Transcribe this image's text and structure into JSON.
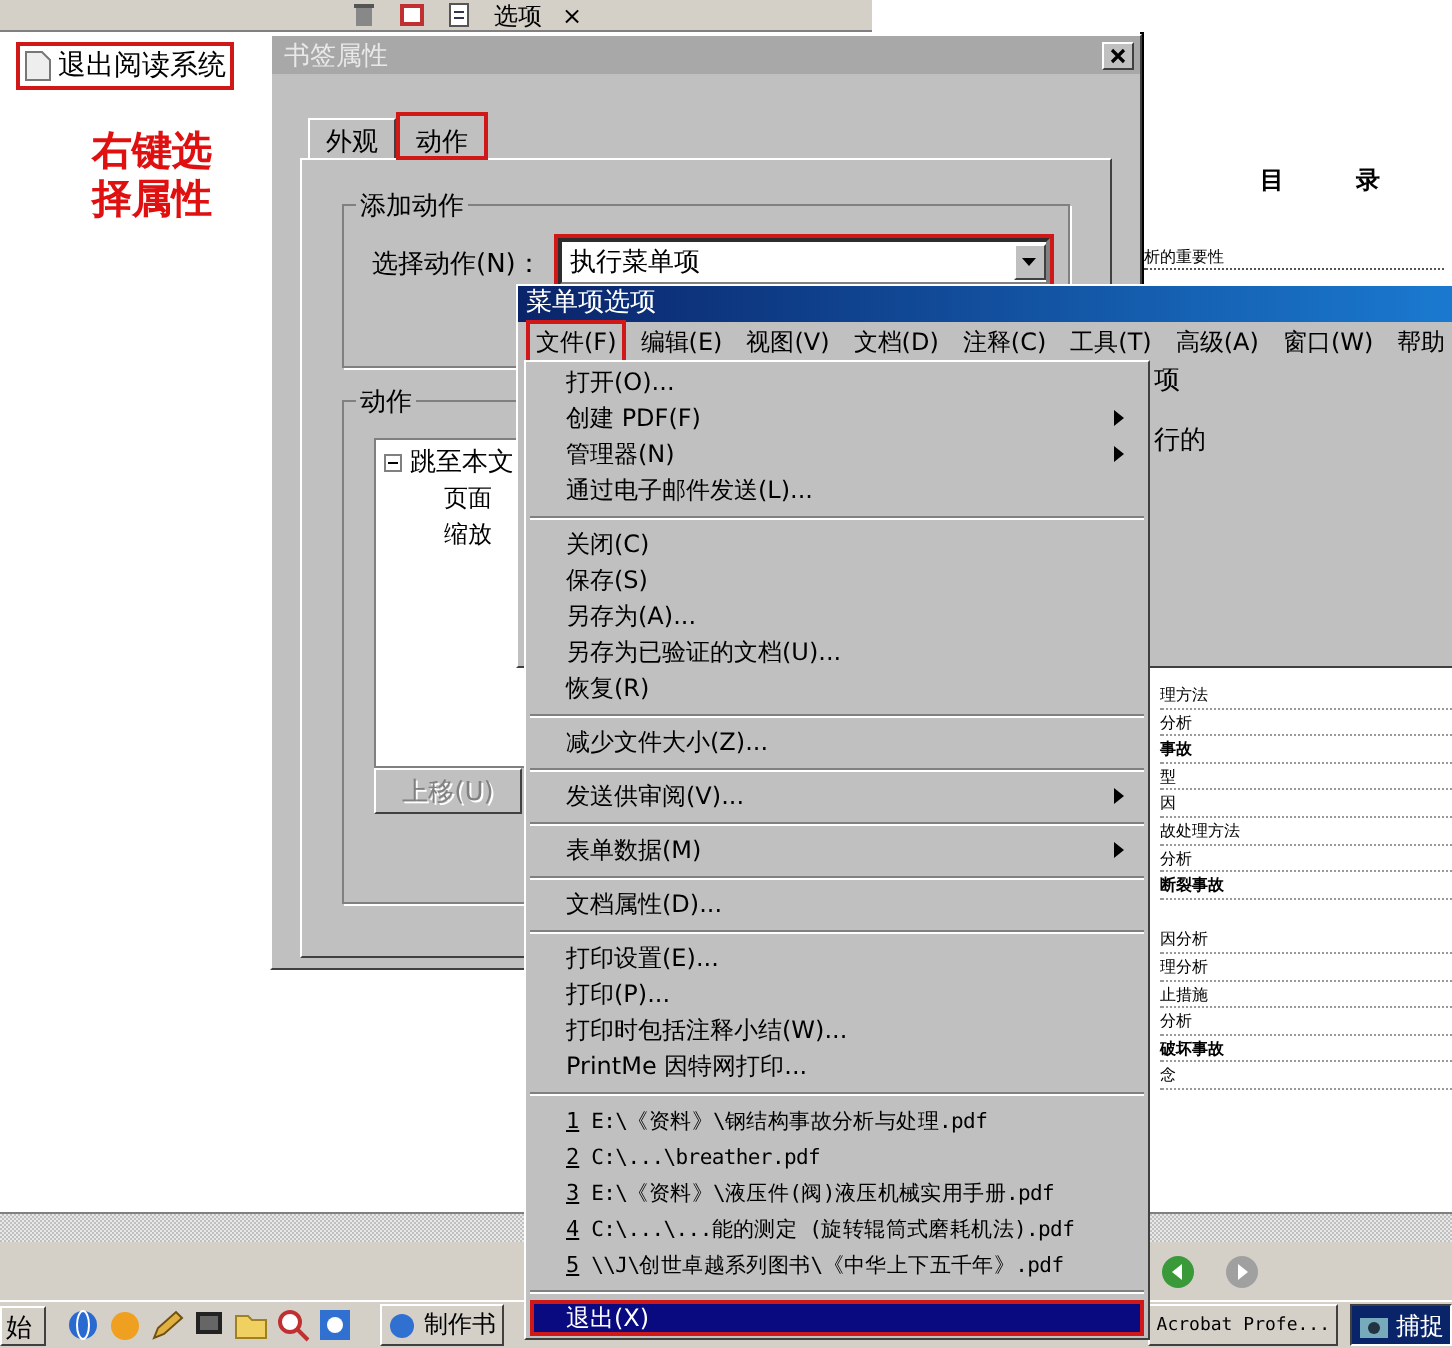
{
  "toolbar": {
    "options_label": "选项",
    "close_label": "×"
  },
  "bookmarks": [
    {
      "label": "退出阅读系统",
      "highlighted": true
    }
  ],
  "annotation": "右键选择属性",
  "document": {
    "heading": [
      "目",
      "录"
    ],
    "first_line": "析的重要性",
    "toc_rows": [
      {
        "text": "理方法",
        "bold": false
      },
      {
        "text": "分析",
        "bold": false
      },
      {
        "text": "事故",
        "bold": true
      },
      {
        "text": "型",
        "bold": false
      },
      {
        "text": "因",
        "bold": false
      },
      {
        "text": "故处理方法",
        "bold": false
      },
      {
        "text": "分析",
        "bold": false
      },
      {
        "text": "断裂事故",
        "bold": true
      },
      {
        "text": "因分析",
        "bold": false
      },
      {
        "text": "理分析",
        "bold": false
      },
      {
        "text": "止措施",
        "bold": false
      },
      {
        "text": "分析",
        "bold": false
      },
      {
        "text": "破坏事故",
        "bold": true
      },
      {
        "text": "念",
        "bold": false
      }
    ]
  },
  "bookmark_dialog": {
    "title": "书签属性",
    "tabs": [
      {
        "label": "外观",
        "selected": false,
        "highlighted": false
      },
      {
        "label": "动作",
        "selected": true,
        "highlighted": true
      }
    ],
    "add_action_group": "添加动作",
    "select_action_label": "选择动作(N)：",
    "select_action_value": "执行菜单项",
    "select_highlighted": true,
    "actions_group": "动作",
    "action_tree": [
      {
        "label": "跳至本文",
        "expanded": true,
        "children": [
          {
            "label": "页面"
          },
          {
            "label": "缩放"
          }
        ]
      }
    ],
    "move_up_button": {
      "label": "上移(U)",
      "disabled": true
    }
  },
  "menu_dialog": {
    "title": "菜单项选项",
    "menubar": [
      {
        "label": "文件(F)",
        "selected": true
      },
      {
        "label": "编辑(E)",
        "selected": false
      },
      {
        "label": "视图(V)",
        "selected": false
      },
      {
        "label": "文档(D)",
        "selected": false
      },
      {
        "label": "注释(C)",
        "selected": false
      },
      {
        "label": "工具(T)",
        "selected": false
      },
      {
        "label": "高级(A)",
        "selected": false
      },
      {
        "label": "窗口(W)",
        "selected": false
      },
      {
        "label": "帮助",
        "selected": false
      }
    ],
    "body_texts": [
      "项",
      "行的"
    ]
  },
  "file_menu": [
    {
      "kind": "item",
      "label": "打开(O)...",
      "submenu": false,
      "selected": false
    },
    {
      "kind": "item",
      "label": "创建 PDF(F)",
      "submenu": true,
      "selected": false
    },
    {
      "kind": "item",
      "label": "管理器(N)",
      "submenu": true,
      "selected": false
    },
    {
      "kind": "item",
      "label": "通过电子邮件发送(L)...",
      "submenu": false,
      "selected": false
    },
    {
      "kind": "separator"
    },
    {
      "kind": "item",
      "label": "关闭(C)",
      "submenu": false,
      "selected": false
    },
    {
      "kind": "item",
      "label": "保存(S)",
      "submenu": false,
      "selected": false
    },
    {
      "kind": "item",
      "label": "另存为(A)...",
      "submenu": false,
      "selected": false
    },
    {
      "kind": "item",
      "label": "另存为已验证的文档(U)...",
      "submenu": false,
      "selected": false
    },
    {
      "kind": "item",
      "label": "恢复(R)",
      "submenu": false,
      "selected": false
    },
    {
      "kind": "separator"
    },
    {
      "kind": "item",
      "label": "减少文件大小(Z)...",
      "submenu": false,
      "selected": false
    },
    {
      "kind": "separator"
    },
    {
      "kind": "item",
      "label": "发送供审阅(V)...",
      "submenu": true,
      "selected": false
    },
    {
      "kind": "separator"
    },
    {
      "kind": "item",
      "label": "表单数据(M)",
      "submenu": true,
      "selected": false
    },
    {
      "kind": "separator"
    },
    {
      "kind": "item",
      "label": "文档属性(D)...",
      "submenu": false,
      "selected": false
    },
    {
      "kind": "separator"
    },
    {
      "kind": "item",
      "label": "打印设置(E)...",
      "submenu": false,
      "selected": false
    },
    {
      "kind": "item",
      "label": "打印(P)...",
      "submenu": false,
      "selected": false
    },
    {
      "kind": "item",
      "label": "打印时包括注释小结(W)...",
      "submenu": false,
      "selected": false
    },
    {
      "kind": "item",
      "label": "PrintMe 因特网打印...",
      "submenu": false,
      "selected": false
    },
    {
      "kind": "separator"
    },
    {
      "kind": "recent",
      "number": "1",
      "label": "E:\\《资料》\\钢结构事故分析与处理.pdf",
      "selected": false
    },
    {
      "kind": "recent",
      "number": "2",
      "label": "C:\\...\\breather.pdf",
      "selected": false
    },
    {
      "kind": "recent",
      "number": "3",
      "label": "E:\\《资料》\\液压件(阀)液压机械实用手册.pdf",
      "selected": false
    },
    {
      "kind": "recent",
      "number": "4",
      "label": "C:\\...\\...能的测定 (旋转辊筒式磨耗机法).pdf",
      "selected": false
    },
    {
      "kind": "recent",
      "number": "5",
      "label": "\\\\J\\创世卓越系列图书\\《中华上下五千年》.pdf",
      "selected": false
    },
    {
      "kind": "separator"
    },
    {
      "kind": "item",
      "label": "退出(X)",
      "submenu": false,
      "selected": true,
      "highlighted": true
    }
  ],
  "taskbar": {
    "start_label": "始",
    "tasks": [
      {
        "label": "制作书",
        "active": false
      },
      {
        "label": "Acrobat Profe...",
        "active": false
      },
      {
        "label": "捕捉",
        "active": true
      }
    ]
  }
}
